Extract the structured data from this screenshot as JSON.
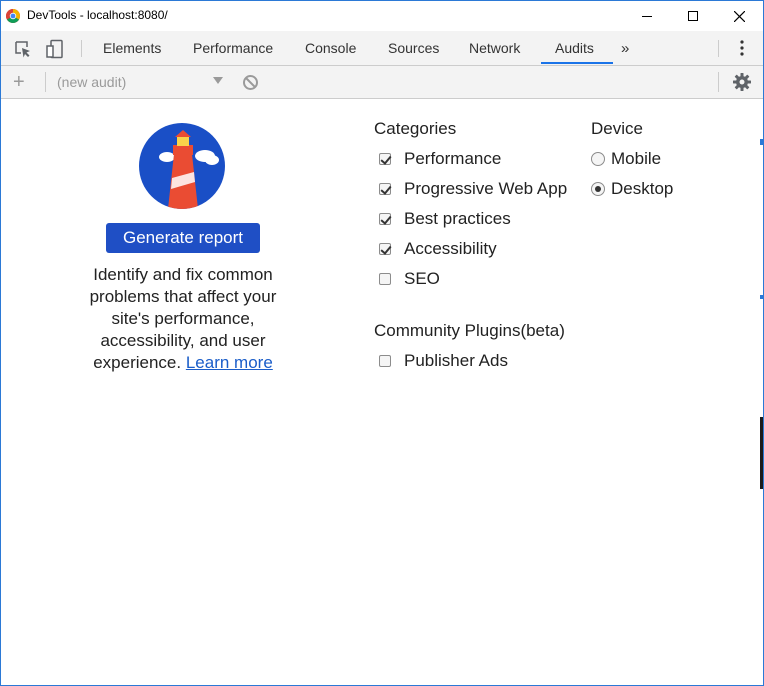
{
  "window": {
    "title": "DevTools - localhost:8080/"
  },
  "tabs": [
    {
      "label": "Elements"
    },
    {
      "label": "Performance"
    },
    {
      "label": "Console"
    },
    {
      "label": "Sources"
    },
    {
      "label": "Network"
    },
    {
      "label": "Audits",
      "active": true
    }
  ],
  "toolbar": {
    "add_label": "+",
    "audit_select_value": "(new audit)"
  },
  "left_panel": {
    "generate_button_label": "Generate report",
    "description": "Identify and fix common problems that affect your site's performance, accessibility, and user experience.",
    "learn_more_label": "Learn more"
  },
  "categories": {
    "title": "Categories",
    "items": [
      {
        "label": "Performance",
        "checked": true
      },
      {
        "label": "Progressive Web App",
        "checked": true
      },
      {
        "label": "Best practices",
        "checked": true
      },
      {
        "label": "Accessibility",
        "checked": true
      },
      {
        "label": "SEO",
        "checked": false
      }
    ]
  },
  "device": {
    "title": "Device",
    "options": [
      {
        "label": "Mobile",
        "selected": false
      },
      {
        "label": "Desktop",
        "selected": true
      }
    ]
  },
  "community_plugins": {
    "title": "Community Plugins(beta)",
    "items": [
      {
        "label": "Publisher Ads",
        "checked": false
      }
    ]
  },
  "colors": {
    "accent": "#1a73e8",
    "button": "#1f4fc5",
    "link": "#1a5dc9"
  }
}
